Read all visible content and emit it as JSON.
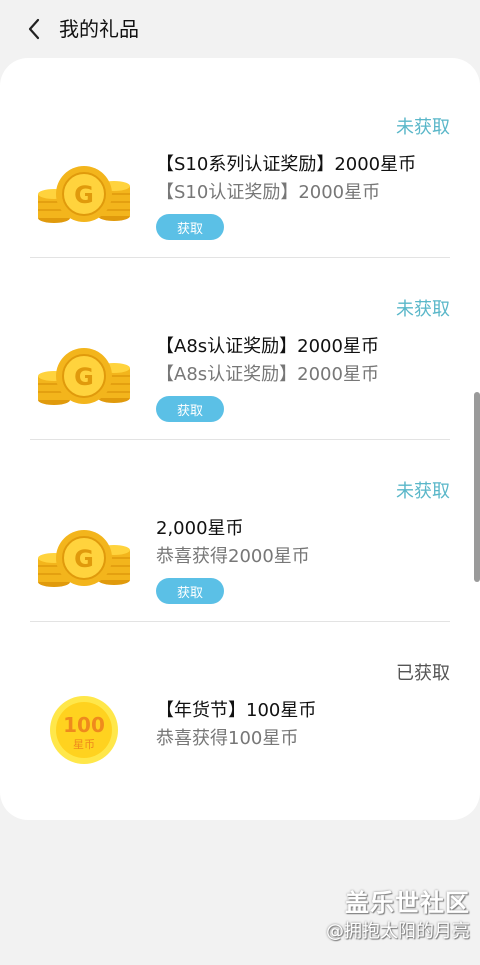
{
  "header": {
    "title": "我的礼品"
  },
  "gifts": [
    {
      "status": "未获取",
      "title": "【S10系列认证奖励】2000星币",
      "subtitle": "【S10认证奖励】2000星币",
      "button": "获取",
      "icon": "gold-coins-icon"
    },
    {
      "status": "未获取",
      "title": "【A8s认证奖励】2000星币",
      "subtitle": "【A8s认证奖励】2000星币",
      "button": "获取",
      "icon": "gold-coins-icon"
    },
    {
      "status": "未获取",
      "title": "2,000星币",
      "subtitle": "恭喜获得2000星币",
      "button": "获取",
      "icon": "gold-coins-icon"
    },
    {
      "status": "已获取",
      "title": "【年货节】100星币",
      "subtitle": "恭喜获得100星币",
      "badge_value": "100",
      "badge_unit": "星币",
      "icon": "star-coin-badge-icon"
    }
  ],
  "watermark": {
    "logo": "盖乐世社区",
    "user": "@拥抱太阳的月亮"
  },
  "colors": {
    "pending_status": "#5ab7c9",
    "claimed_status": "#555555",
    "button_bg": "#5bc0e6",
    "coin_gold": "#f3b51c"
  }
}
